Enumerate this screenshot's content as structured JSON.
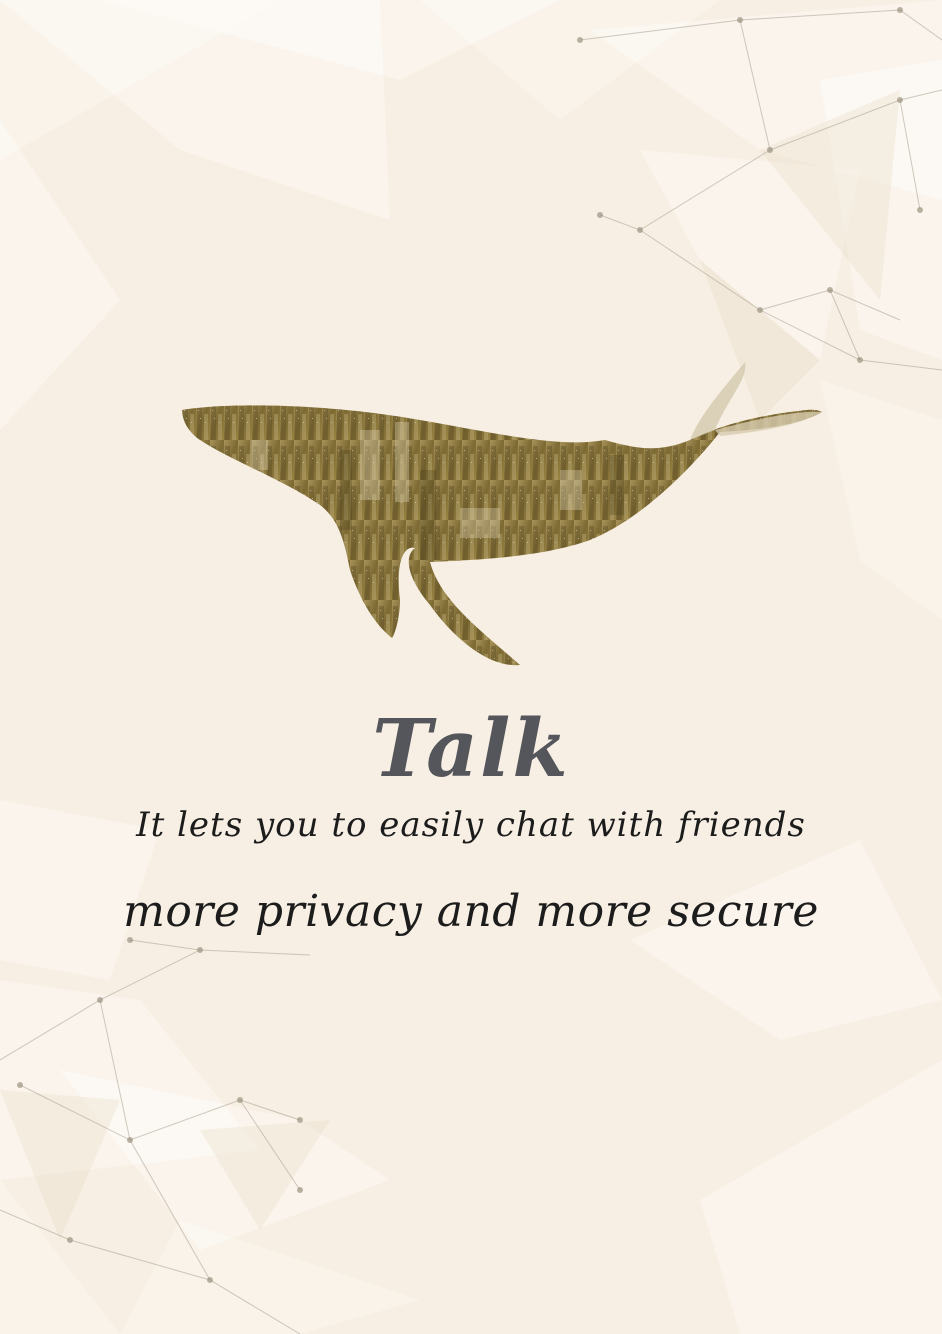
{
  "splash": {
    "app_name": "Talk",
    "tagline_line1": "It lets you to easily chat with friends",
    "tagline_line2": "more privacy and more secure"
  },
  "colors": {
    "background": "#f7efe3",
    "title": "#55565c",
    "tagline": "#1c1c1c",
    "whale_fill": "#8a7536"
  },
  "icons": {
    "hero_image": "whale-city-silhouette",
    "background_pattern": "low-poly-network"
  }
}
